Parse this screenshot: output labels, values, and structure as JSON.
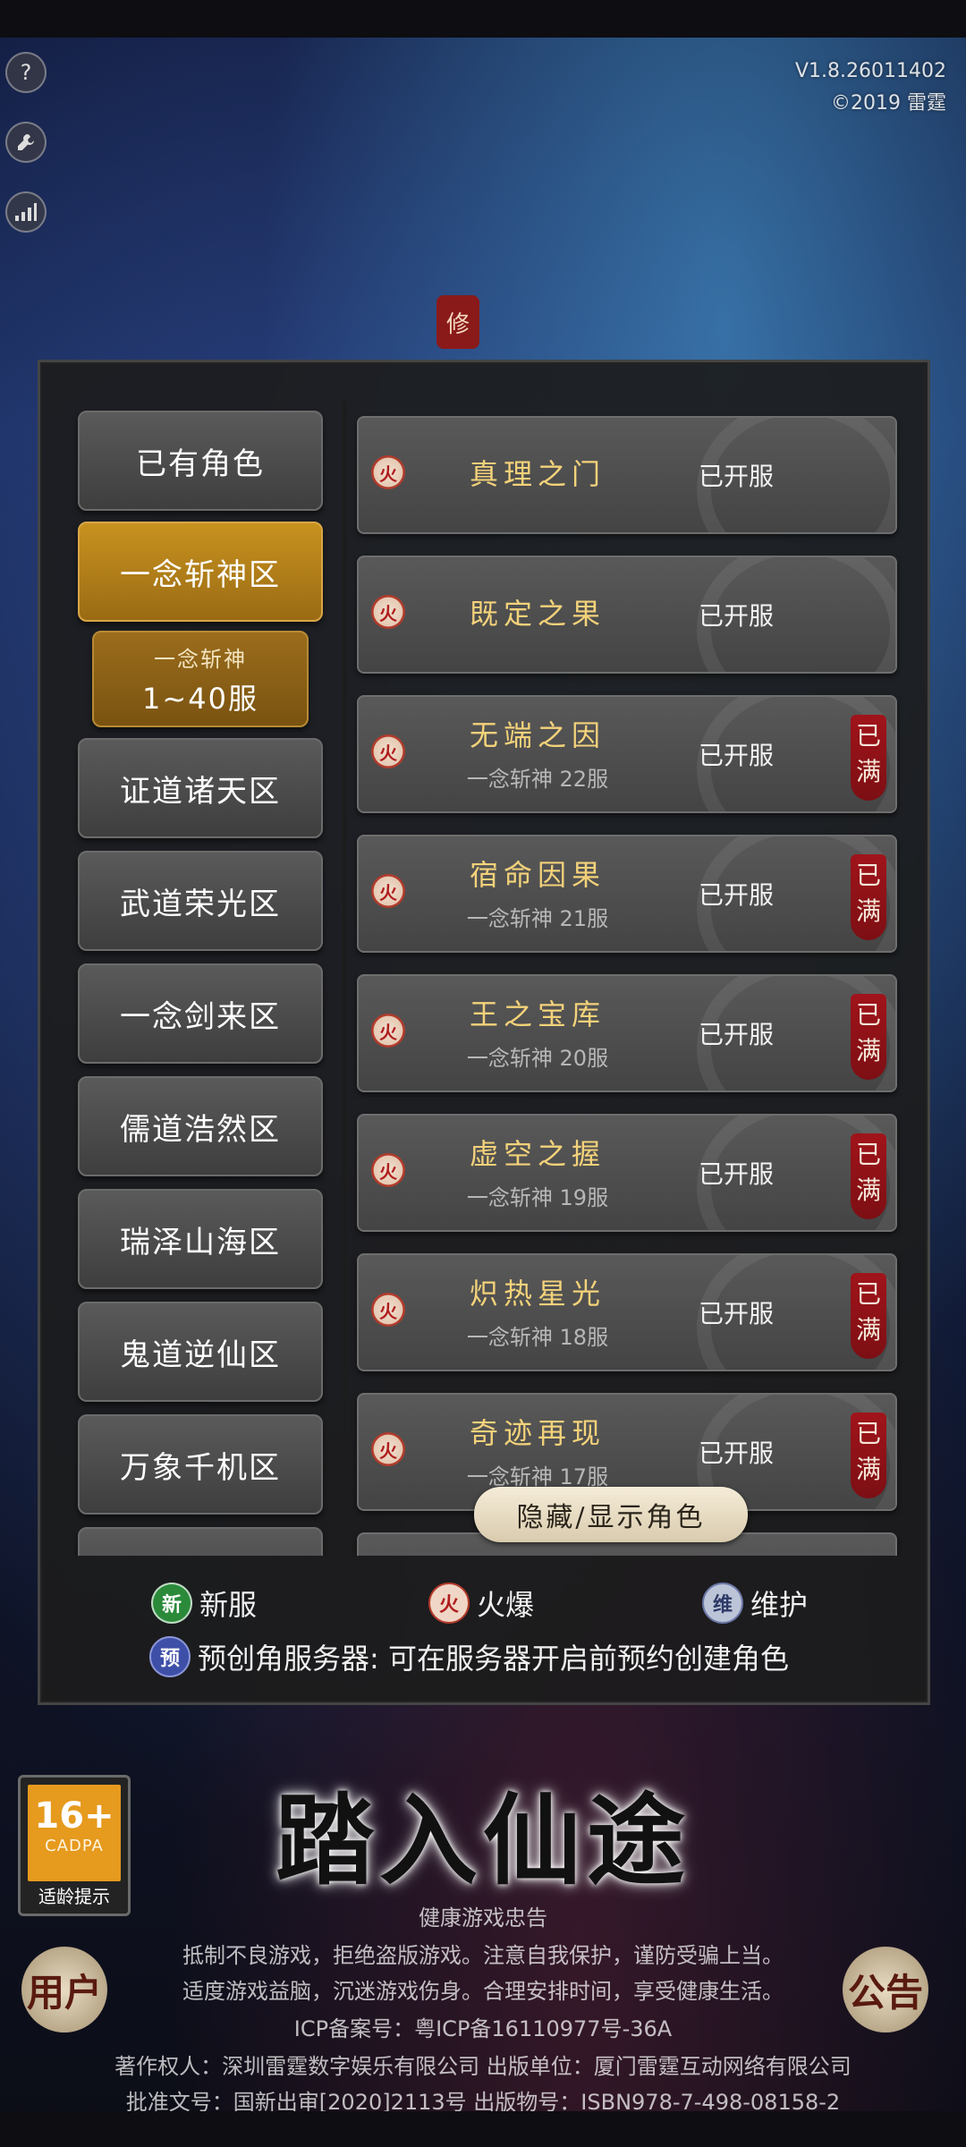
{
  "version": {
    "line1": "V1.8.26011402",
    "line2": "©2019 雷霆"
  },
  "seal": "修",
  "left_menu": [
    {
      "label": "已有角色",
      "active": false
    },
    {
      "label": "一念斩神区",
      "active": true
    },
    {
      "label": "证道诸天区",
      "active": false
    },
    {
      "label": "武道荣光区",
      "active": false
    },
    {
      "label": "一念剑来区",
      "active": false
    },
    {
      "label": "儒道浩然区",
      "active": false
    },
    {
      "label": "瑞泽山海区",
      "active": false
    },
    {
      "label": "鬼道逆仙区",
      "active": false
    },
    {
      "label": "万象千机区",
      "active": false
    }
  ],
  "sub_range": {
    "line1": "一念斩神",
    "line2": "1~40服"
  },
  "servers": [
    {
      "name": "真理之门",
      "sub": "",
      "status": "已开服",
      "full": false
    },
    {
      "name": "既定之果",
      "sub": "",
      "status": "已开服",
      "full": false
    },
    {
      "name": "无端之因",
      "sub": "一念斩神 22服",
      "status": "已开服",
      "full": true
    },
    {
      "name": "宿命因果",
      "sub": "一念斩神 21服",
      "status": "已开服",
      "full": true
    },
    {
      "name": "王之宝库",
      "sub": "一念斩神 20服",
      "status": "已开服",
      "full": true
    },
    {
      "name": "虚空之握",
      "sub": "一念斩神 19服",
      "status": "已开服",
      "full": true
    },
    {
      "name": "炽热星光",
      "sub": "一念斩神 18服",
      "status": "已开服",
      "full": true
    },
    {
      "name": "奇迹再现",
      "sub": "一念斩神 17服",
      "status": "已开服",
      "full": true
    }
  ],
  "full_badge": "已满",
  "hot_icon": "火",
  "toggle_label": "隐藏/显示角色",
  "legend": {
    "new_icon": "新",
    "new_label": "新服",
    "hot_icon": "火",
    "hot_label": "火爆",
    "maint_icon": "维",
    "maint_label": "维护",
    "pre_icon": "预",
    "pre_label": "预创角服务器: 可在服务器开启前预约创建角色"
  },
  "age": {
    "rating": "16+",
    "org": "CADPA",
    "tip": "适龄提示"
  },
  "title": "踏入仙途",
  "footer": {
    "heading": "健康游戏忠告",
    "line1": "抵制不良游戏，拒绝盗版游戏。注意自我保护，谨防受骗上当。",
    "line2": "适度游戏益脑，沉迷游戏伤身。合理安排时间，享受健康生活。",
    "icp": "ICP备案号：粤ICP备16110977号-36A",
    "copyright": "著作权人：深圳雷霆数字娱乐有限公司 出版单位：厦门雷霆互动网络有限公司",
    "approval": "批准文号：国新出审[2020]2113号 出版物号：ISBN978-7-498-08158-2"
  },
  "corner_left": "用户",
  "corner_right": "公告",
  "icons": {
    "help": "help-icon",
    "tools": "wrench-icon",
    "signal": "signal-icon"
  },
  "colors": {
    "gold": "#c8921f",
    "server_name": "#f3d27a",
    "full_red": "#a0141a"
  }
}
